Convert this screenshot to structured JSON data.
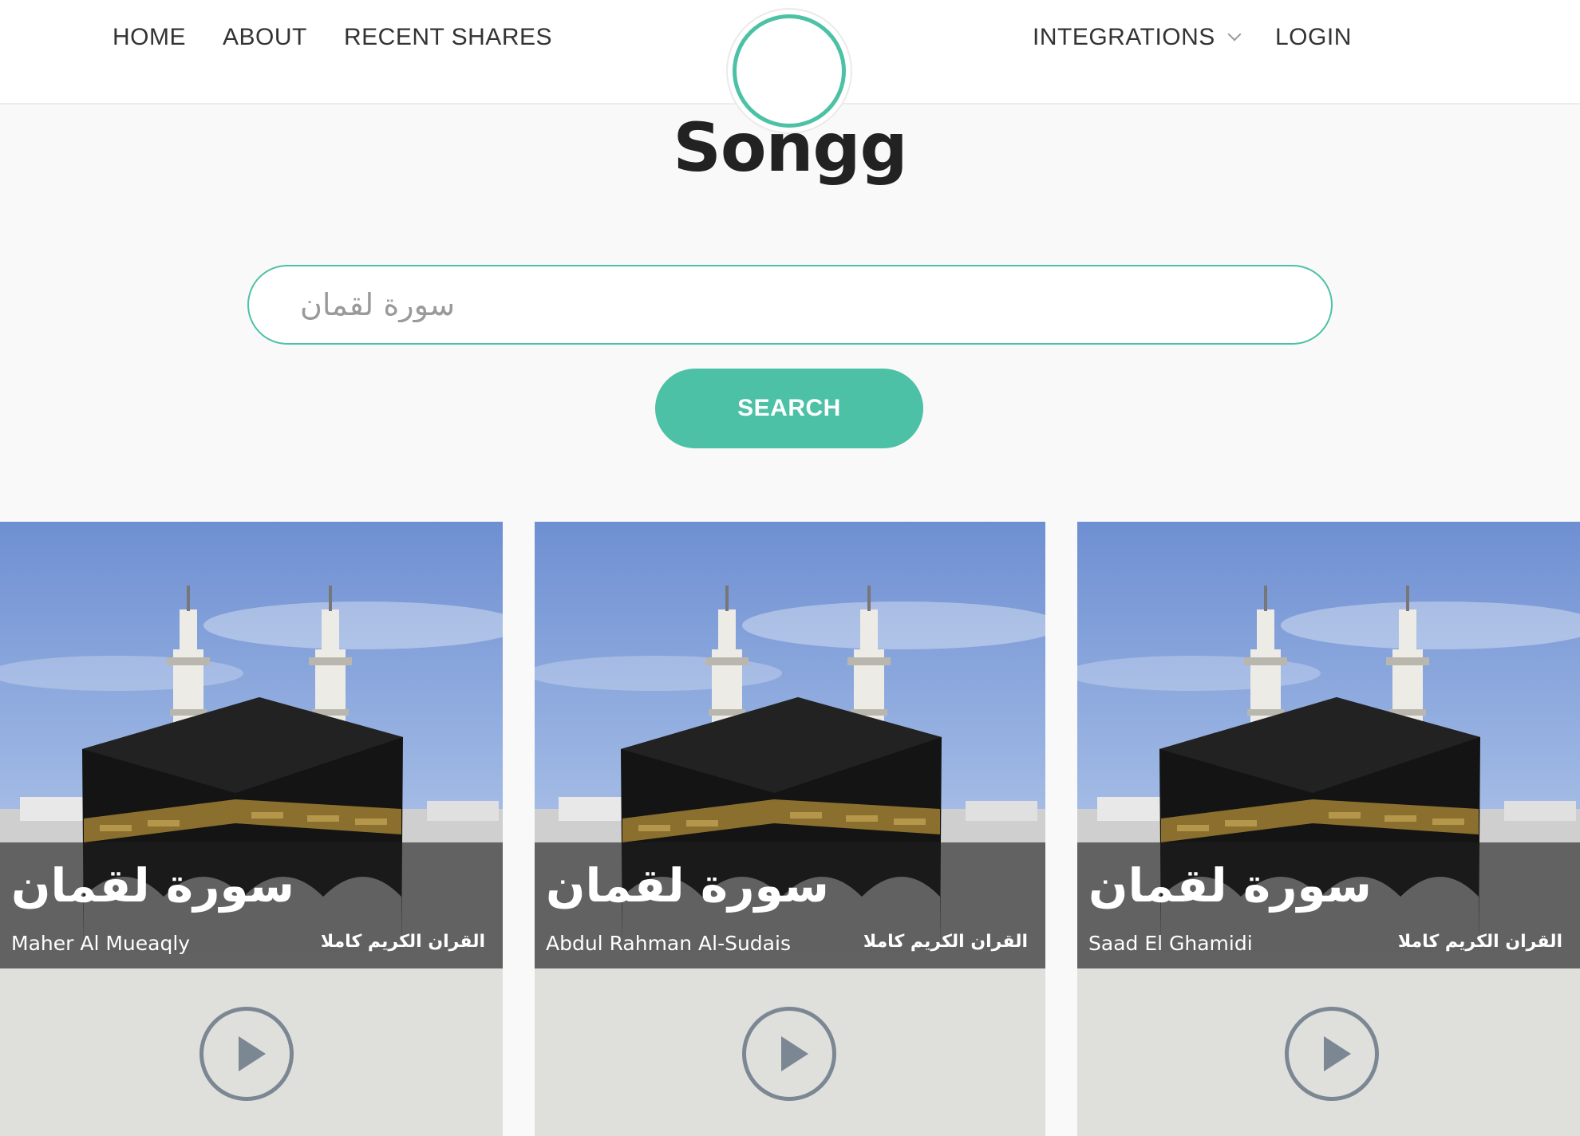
{
  "nav": {
    "home": "HOME",
    "about": "ABOUT",
    "recent_shares": "RECENT SHARES",
    "integrations": "INTEGRATIONS",
    "login": "LOGIN"
  },
  "brand": {
    "name": "Songg"
  },
  "search": {
    "placeholder": "سورة لقمان",
    "value": "",
    "button_label": "SEARCH"
  },
  "cards": [
    {
      "title": "سورة لقمان",
      "artist": "Maher Al Mueaqly",
      "album": "القران الكريم كاملا"
    },
    {
      "title": "سورة لقمان",
      "artist": "Abdul Rahman Al-Sudais",
      "album": "القران الكريم كاملا"
    },
    {
      "title": "سورة لقمان",
      "artist": "Saad El Ghamidi",
      "album": "القران الكريم كاملا"
    }
  ],
  "icons": {
    "logo": "sound-wave-logo-icon",
    "dropdown": "chevron-down-icon",
    "play": "play-icon"
  },
  "colors": {
    "accent": "#4cc1a6",
    "play_icon": "#7b8793",
    "card_bg": "#dfdfdc",
    "page_bg": "#f9f9f9"
  }
}
